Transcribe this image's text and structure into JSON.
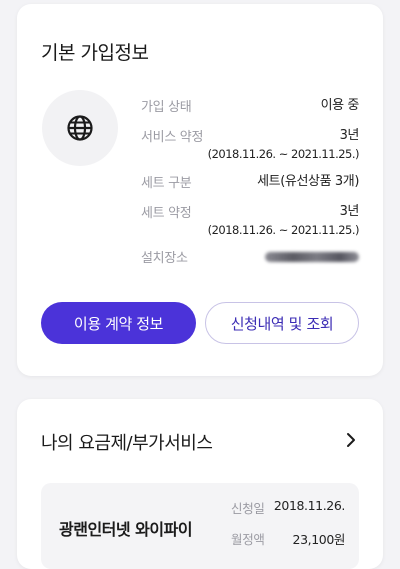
{
  "basic_info": {
    "title": "기본 가입정보",
    "icon": "globe-icon",
    "rows": [
      {
        "label": "가입 상태",
        "value": "이용 중",
        "sub": ""
      },
      {
        "label": "서비스 약정",
        "value": "3년",
        "sub": "(2018.11.26. ~ 2021.11.25.)"
      },
      {
        "label": "세트 구분",
        "value": "세트(유선상품 3개)",
        "sub": ""
      },
      {
        "label": "세트 약정",
        "value": "3년",
        "sub": "(2018.11.26. ~ 2021.11.25.)"
      },
      {
        "label": "설치장소",
        "value": "",
        "sub": ""
      }
    ],
    "install_location_redacted": true,
    "contract_button": "이용 계약 정보",
    "history_button": "신청내역 및 조회"
  },
  "plans": {
    "title": "나의 요금제/부가서비스",
    "item": {
      "name": "광랜인터넷 와이파이",
      "apply_label": "신청일",
      "apply_value": "2018.11.26.",
      "fee_label": "월정액",
      "fee_value": "23,100원"
    }
  },
  "colors": {
    "accent": "#4b33d9",
    "outline_text": "#3c2db5",
    "background": "#f3f3f6"
  }
}
